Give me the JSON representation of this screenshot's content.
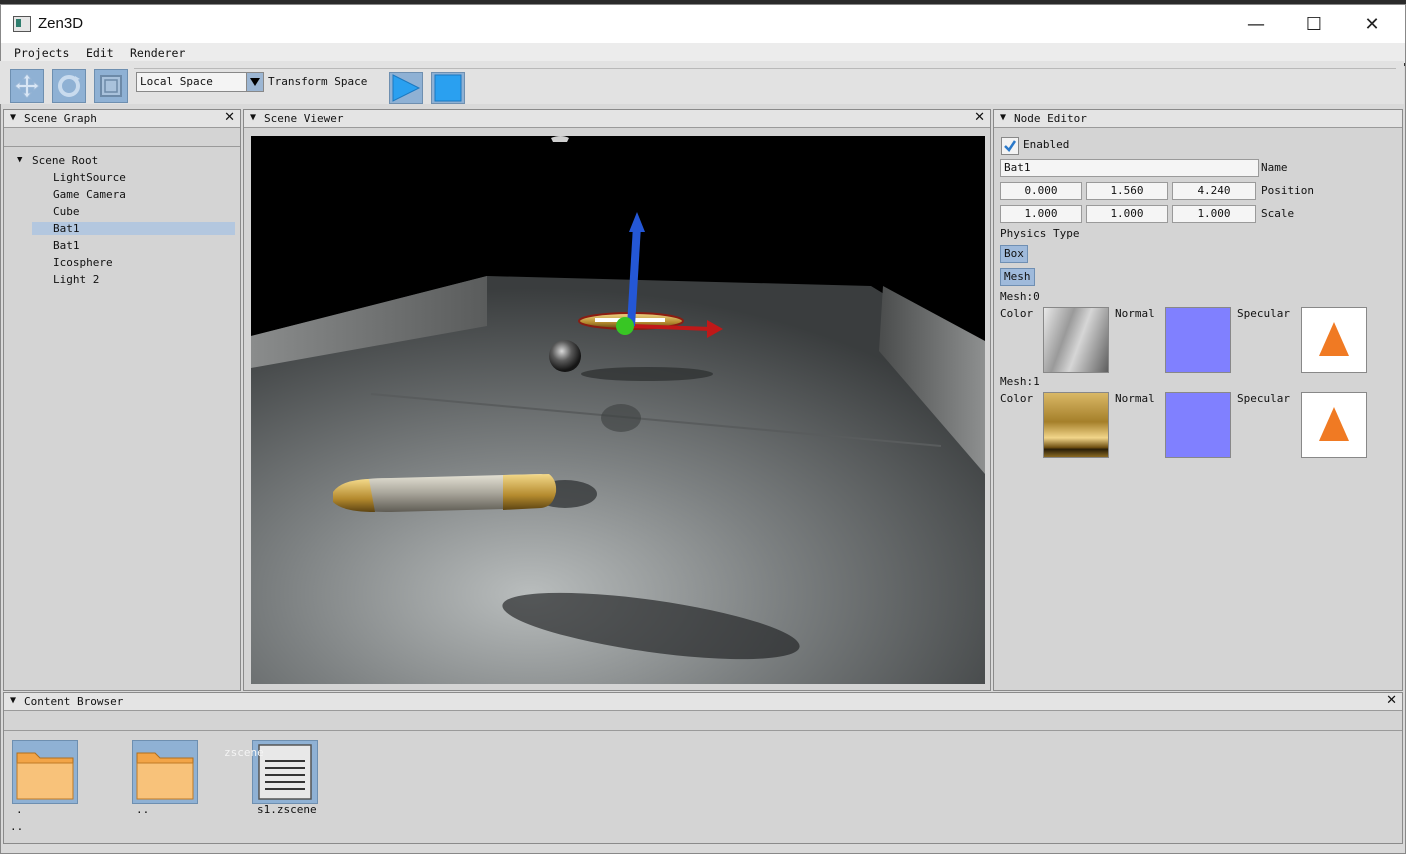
{
  "window": {
    "title": "Zen3D"
  },
  "menu": [
    "Projects",
    "Edit",
    "Renderer"
  ],
  "toolbar": {
    "tools": [
      "move-tool",
      "rotate-tool",
      "scale-tool"
    ],
    "space_value": "Local Space",
    "space_label": "Transform Space",
    "play": "play",
    "stop": "stop"
  },
  "scene_graph": {
    "title": "Scene Graph",
    "root": "Scene Root",
    "items": [
      "LightSource",
      "Game Camera",
      "Cube",
      "Bat1",
      "Bat1",
      "Icosphere",
      "Light 2"
    ],
    "selected_index": 3
  },
  "scene_viewer": {
    "title": "Scene Viewer"
  },
  "node_editor": {
    "title": "Node Editor",
    "enabled_label": "Enabled",
    "enabled": true,
    "name_value": "Bat1",
    "name_label": "Name",
    "position": [
      "0.000",
      "1.560",
      "4.240"
    ],
    "position_label": "Position",
    "scale": [
      "1.000",
      "1.000",
      "1.000"
    ],
    "scale_label": "Scale",
    "physics_label": "Physics Type",
    "physics_options": [
      "Box",
      "Mesh"
    ],
    "meshes": [
      {
        "label": "Mesh:0",
        "color": "Color",
        "normal": "Normal",
        "specular": "Specular"
      },
      {
        "label": "Mesh:1",
        "color": "Color",
        "normal": "Normal",
        "specular": "Specular"
      }
    ],
    "colors": {
      "normal_map": "#8080ff",
      "accent": "#f07a23"
    }
  },
  "content_browser": {
    "title": "Content Browser",
    "items": [
      {
        "label": ".",
        "type": "folder"
      },
      {
        "label": "..",
        "type": "folder"
      },
      {
        "label": "s1.zscene",
        "type": "file",
        "tag": "zscene"
      }
    ],
    "footer": ".."
  }
}
